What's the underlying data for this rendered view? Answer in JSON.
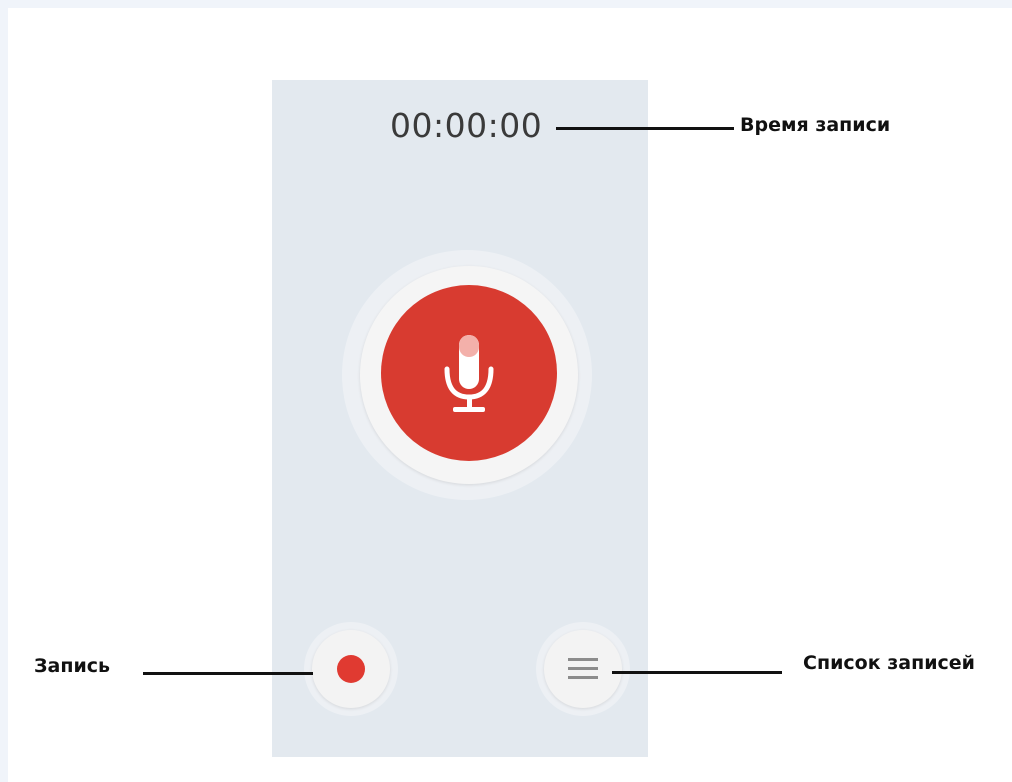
{
  "recorder": {
    "elapsed_time": "00:00:00",
    "accent_color": "#d83b30",
    "screen_background": "#e3e9ef",
    "main_button_icon": "microphone-icon",
    "record_button_icon": "record-dot-icon",
    "list_button_icon": "list-icon"
  },
  "callouts": {
    "recording_time": "Время записи",
    "record": "Запись",
    "recordings_list": "Список записей"
  }
}
